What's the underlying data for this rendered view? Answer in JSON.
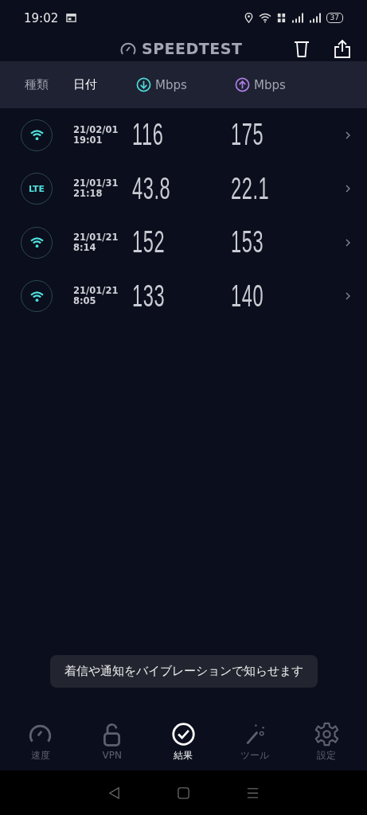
{
  "status_bar": {
    "time": "19:02",
    "battery": "37"
  },
  "header": {
    "title": "SPEEDTEST"
  },
  "columns": [
    {
      "label": "種類",
      "kind": "text",
      "selected": false
    },
    {
      "label": "日付",
      "kind": "text",
      "selected": true
    },
    {
      "label": "Mbps",
      "kind": "download",
      "selected": false
    },
    {
      "label": "Mbps",
      "kind": "upload",
      "selected": false
    }
  ],
  "results": [
    {
      "network": {
        "kind": "wifi"
      },
      "date": "21/02/01",
      "time": "19:01",
      "download": "116",
      "upload": "175"
    },
    {
      "network": {
        "kind": "lte",
        "label": "LTE"
      },
      "date": "21/01/31",
      "time": "21:18",
      "download": "43.8",
      "upload": "22.1"
    },
    {
      "network": {
        "kind": "wifi"
      },
      "date": "21/01/21",
      "time": "8:14",
      "download": "152",
      "upload": "153"
    },
    {
      "network": {
        "kind": "wifi"
      },
      "date": "21/01/21",
      "time": "8:05",
      "download": "133",
      "upload": "140"
    }
  ],
  "toast": "着信や通知をバイブレーションで知らせます",
  "bottom_nav": [
    {
      "label": "速度",
      "kind": "gauge",
      "selected": false
    },
    {
      "label": "VPN",
      "kind": "lock",
      "selected": false
    },
    {
      "label": "結果",
      "kind": "check",
      "selected": true
    },
    {
      "label": "ツール",
      "kind": "wand",
      "selected": false
    },
    {
      "label": "設定",
      "kind": "gear",
      "selected": false
    }
  ]
}
